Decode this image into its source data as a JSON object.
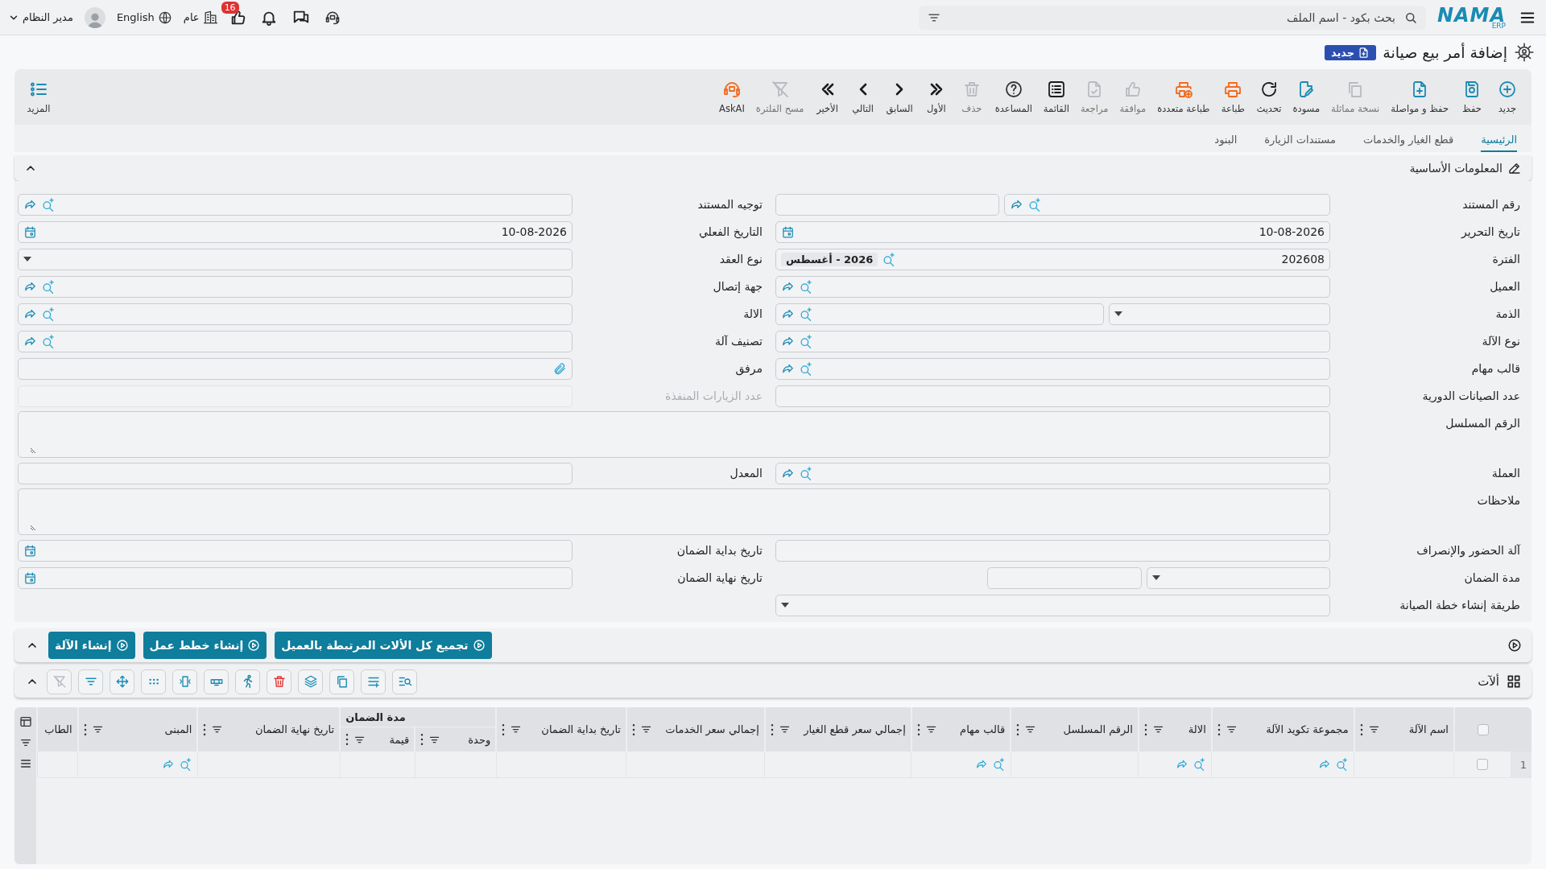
{
  "top_bar": {
    "logo": "NAMA",
    "logo_sub": "ERP",
    "search": {
      "placeholder": "بحث بكود - اسم الملف"
    },
    "company": "عام",
    "notifications_count": "16",
    "language": "English",
    "user": "مدير النظام"
  },
  "page": {
    "title": "إضافة أمر بيع صيانة",
    "badge": "جديد"
  },
  "toolbar": {
    "items": [
      {
        "label": "جديد",
        "kind": "plus-circle",
        "disabled": false
      },
      {
        "label": "حفظ",
        "kind": "save",
        "disabled": false
      },
      {
        "label": "حفظ و مواصلة",
        "kind": "file-plus",
        "disabled": false
      },
      {
        "label": "نسخة مماثلة",
        "kind": "copy",
        "disabled": true
      },
      {
        "label": "مسودة",
        "kind": "doc-edit",
        "disabled": false
      },
      {
        "label": "تحديث",
        "kind": "refresh",
        "disabled": false
      },
      {
        "label": "طباعة",
        "kind": "printer",
        "disabled": false
      },
      {
        "label": "طباعة متعددة",
        "kind": "printer-plus",
        "disabled": false
      },
      {
        "label": "موافقة",
        "kind": "thumb",
        "disabled": true
      },
      {
        "label": "مراجعة",
        "kind": "doc-check",
        "disabled": true
      },
      {
        "label": "القائمة",
        "kind": "list",
        "disabled": false
      },
      {
        "label": "المساعدة",
        "kind": "help",
        "disabled": false
      },
      {
        "label": "حذف",
        "kind": "trash",
        "disabled": true
      },
      {
        "label": "الأول",
        "kind": "chevrons-right",
        "disabled": false
      },
      {
        "label": "السابق",
        "kind": "chevron-right",
        "disabled": false
      },
      {
        "label": "التالي",
        "kind": "chevron-left",
        "disabled": false
      },
      {
        "label": "الأخير",
        "kind": "chevrons-left",
        "disabled": false
      },
      {
        "label": "مسح الفلترة",
        "kind": "filter-off",
        "disabled": true
      },
      {
        "label": "AskAI",
        "kind": "ai",
        "disabled": false
      }
    ],
    "more": "المزيد"
  },
  "tabs": [
    {
      "label": "الرئيسية",
      "selected": true
    },
    {
      "label": "قطع الغيار والخدمات",
      "selected": false
    },
    {
      "label": "مستندات الزيارة",
      "selected": false
    },
    {
      "label": "البنود",
      "selected": false
    }
  ],
  "section": {
    "title": "المعلومات الأساسية",
    "expanded": true
  },
  "form": {
    "rows": [
      {
        "right": {
          "label": "رقم المستند",
          "kind": "lookup_text",
          "disabled": false
        },
        "left": {
          "label": "توجيه المستند",
          "kind": "lookup",
          "disabled": false
        }
      },
      {
        "right": {
          "label": "تاريخ التحرير",
          "kind": "date",
          "value": "10-08-2026",
          "disabled": false
        },
        "left": {
          "label": "التاريخ الفعلي",
          "kind": "date",
          "value": "10-08-2026",
          "disabled": false
        }
      },
      {
        "right": {
          "label": "الفترة",
          "kind": "period",
          "value": "202608",
          "chip": "2026 - أغسطس",
          "disabled": false
        },
        "left": {
          "label": "نوع العقد",
          "kind": "dropdown",
          "disabled": false
        }
      },
      {
        "right": {
          "label": "العميل",
          "kind": "lookup",
          "disabled": false
        },
        "left": {
          "label": "جهة إتصال",
          "kind": "lookup",
          "disabled": false
        }
      },
      {
        "right": {
          "label": "الذمة",
          "kind": "dropdown_lookup",
          "disabled": false
        },
        "left": {
          "label": "الالة",
          "kind": "lookup",
          "disabled": false
        }
      },
      {
        "right": {
          "label": "نوع الآلة",
          "kind": "lookup",
          "disabled": false
        },
        "left": {
          "label": "تصنيف آلة",
          "kind": "lookup",
          "disabled": false
        }
      },
      {
        "right": {
          "label": "قالب مهام",
          "kind": "lookup",
          "disabled": false
        },
        "left": {
          "label": "مرفق",
          "kind": "attach",
          "disabled": false
        }
      },
      {
        "right": {
          "label": "عدد الصيانات الدورية",
          "kind": "text",
          "disabled": false
        },
        "left": {
          "label": "عدد الزيارات المنفذة",
          "kind": "text",
          "disabled": true
        }
      },
      {
        "wide": {
          "label": "الرقم المسلسل",
          "kind": "textarea",
          "disabled": false
        }
      },
      {
        "right": {
          "label": "العملة",
          "kind": "lookup",
          "disabled": false
        },
        "left": {
          "label": "المعدل",
          "kind": "text",
          "disabled": false
        }
      },
      {
        "wide": {
          "label": "ملاحظات",
          "kind": "textarea",
          "disabled": false
        }
      },
      {
        "right": {
          "label": "آلة الحضور والإنصراف",
          "kind": "text",
          "disabled": false
        },
        "left": {
          "label": "تاريخ بداية الضمان",
          "kind": "date",
          "disabled": false
        }
      },
      {
        "right": {
          "label": "مدة الضمان",
          "kind": "dropdown_text",
          "disabled": false
        },
        "left": {
          "label": "تاريخ نهاية الضمان",
          "kind": "date",
          "disabled": false
        }
      },
      {
        "right": {
          "label": "طريقة إنشاء خطة الصيانة",
          "kind": "dropdown",
          "disabled": false
        }
      }
    ]
  },
  "actions": {
    "expanded": true,
    "buttons": [
      "تجميع كل الألات المرتبطة بالعميل",
      "إنشاء خطط عمل",
      "إنشاء الآلة"
    ]
  },
  "machines": {
    "title": "ألآت",
    "expanded": true,
    "tools": [
      {
        "kind": "search-list",
        "disabled": false
      },
      {
        "kind": "add-row",
        "disabled": false
      },
      {
        "kind": "copy",
        "disabled": false
      },
      {
        "kind": "layers",
        "disabled": false
      },
      {
        "kind": "trash",
        "disabled": false
      },
      {
        "kind": "run",
        "disabled": false
      },
      {
        "kind": "table-rows",
        "disabled": false
      },
      {
        "kind": "fit-columns",
        "disabled": false
      },
      {
        "kind": "dots",
        "disabled": false
      },
      {
        "kind": "move",
        "disabled": false
      },
      {
        "kind": "filter-lines",
        "disabled": false
      },
      {
        "kind": "filter-off",
        "disabled": true
      }
    ],
    "table": {
      "all_checked": false,
      "columns": [
        {
          "label": "اسم الآلة",
          "kind": "text"
        },
        {
          "label": "مجموعة تكويد الآلة",
          "kind": "lookup"
        },
        {
          "label": "الالة",
          "kind": "lookup"
        },
        {
          "label": "الرقم المسلسل",
          "kind": "text"
        },
        {
          "label": "قالب مهام",
          "kind": "lookup"
        },
        {
          "label": "إجمالي سعر قطع الغيار",
          "kind": "text"
        },
        {
          "label": "إجمالي سعر الخدمات",
          "kind": "text"
        },
        {
          "label": "تاريخ بداية الضمان",
          "kind": "text"
        },
        {
          "label": "مدة الضمان",
          "kind": "group",
          "subcolumns": [
            {
              "label": "وحدة"
            },
            {
              "label": "قيمة"
            }
          ]
        },
        {
          "label": "تاريخ نهاية الضمان",
          "kind": "text"
        },
        {
          "label": "المبنى",
          "kind": "lookup"
        },
        {
          "label": "الطاب",
          "kind": "cut"
        }
      ],
      "rows": [
        {
          "number": "1",
          "checked": false
        }
      ]
    }
  }
}
